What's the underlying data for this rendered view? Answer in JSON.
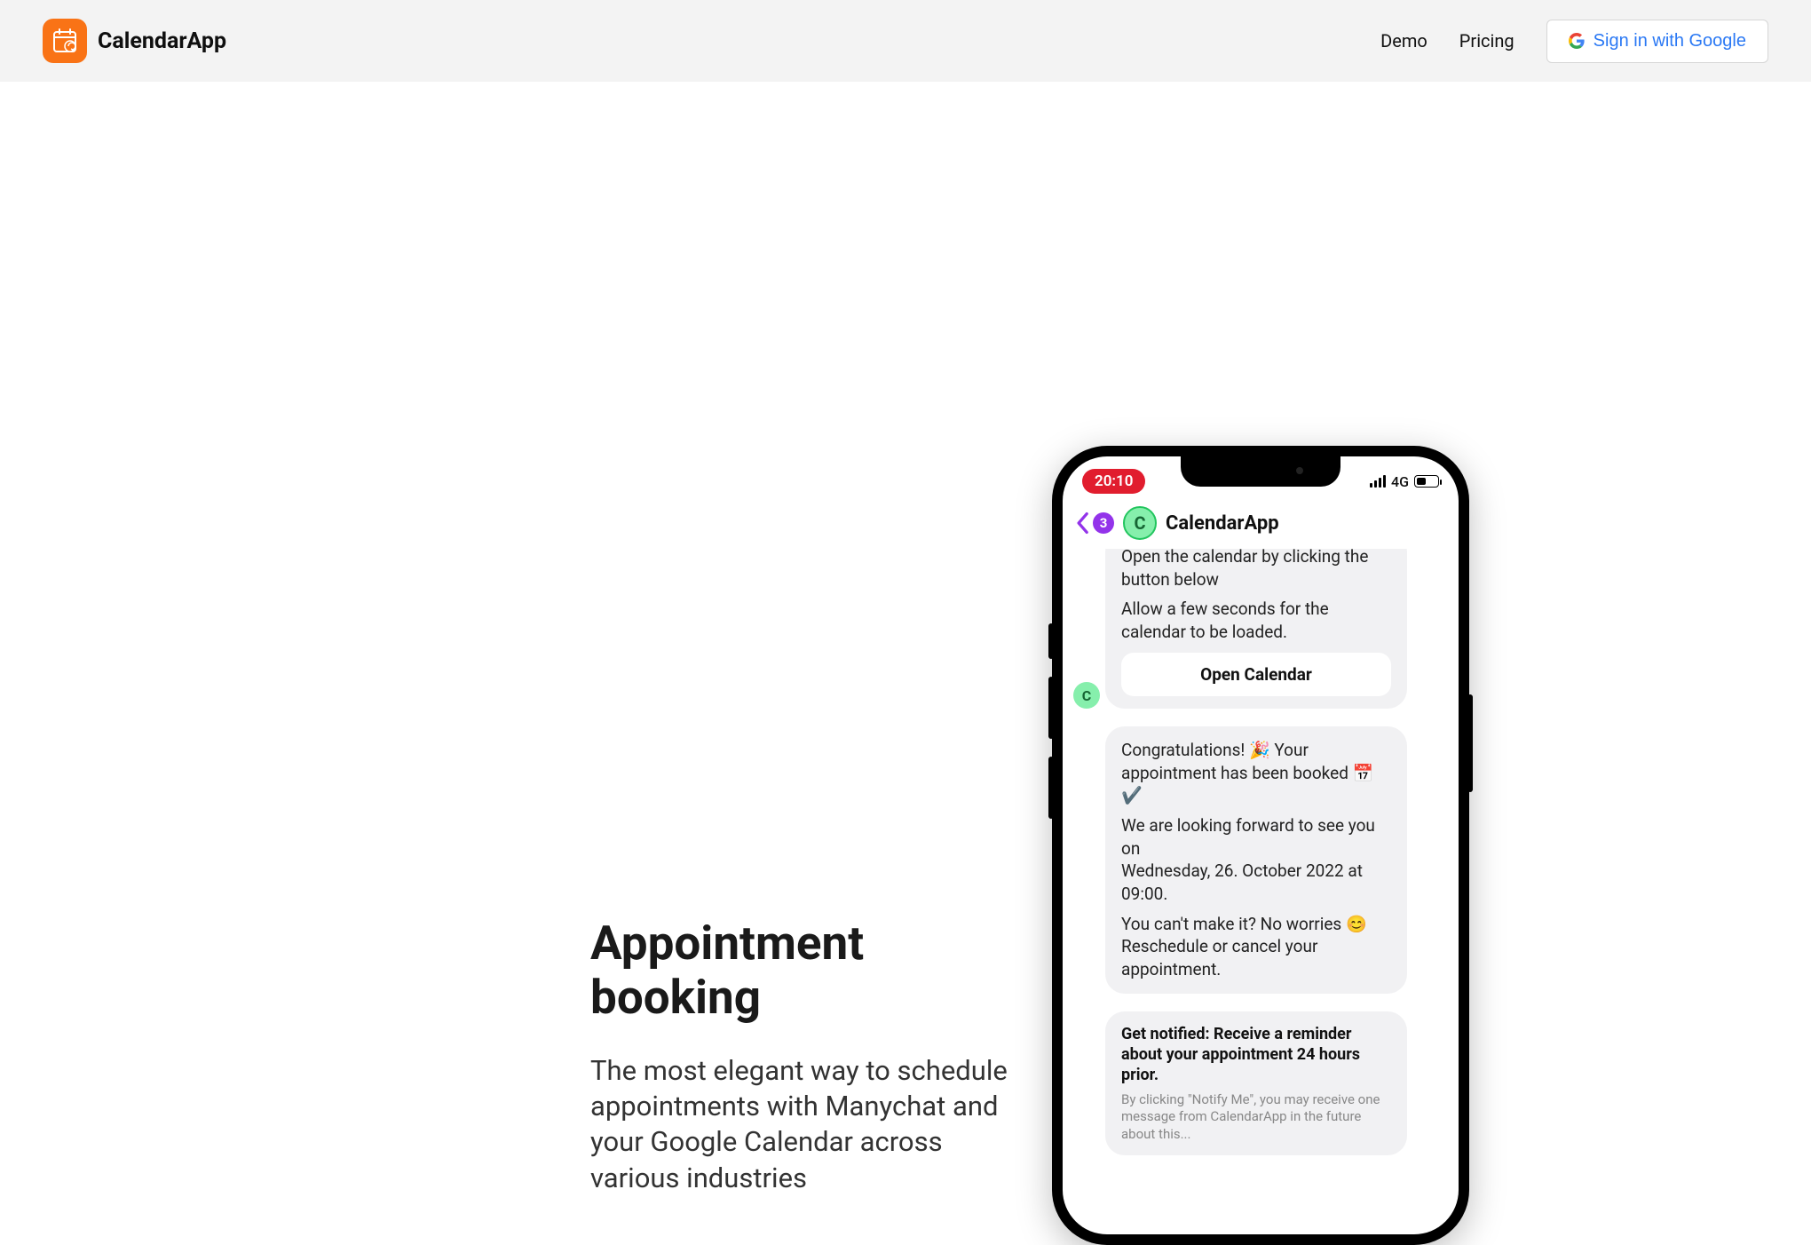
{
  "header": {
    "brand": "CalendarApp",
    "nav": {
      "demo": "Demo",
      "pricing": "Pricing"
    },
    "signin": "Sign in with Google"
  },
  "hero": {
    "title": "Appointment booking",
    "subtitle": "The most elegant way to schedule appointments with Manychat and your Google Calendar across various industries"
  },
  "phone": {
    "status": {
      "time": "20:10",
      "network": "4G"
    },
    "chat": {
      "back_badge": "3",
      "avatar_initial": "C",
      "app_name": "CalendarApp",
      "msg1_line1": "Open the calendar by clicking the button below",
      "msg1_line2": "Allow a few seconds for the calendar to be loaded.",
      "open_button": "Open Calendar",
      "msg2_p1": "Congratulations! 🎉 Your appointment has been booked 📅✔️",
      "msg2_p2a": "We are looking forward to see you on",
      "msg2_p2b": "Wednesday, 26. October 2022 at 09:00.",
      "msg2_p3": "You can't make it? No worries 😊 Reschedule or cancel your appointment.",
      "notify_head": "Get notified: Receive a reminder about your appointment 24 hours prior.",
      "notify_fine": "By clicking \"Notify Me\", you may receive one message from CalendarApp in the future about this..."
    }
  }
}
